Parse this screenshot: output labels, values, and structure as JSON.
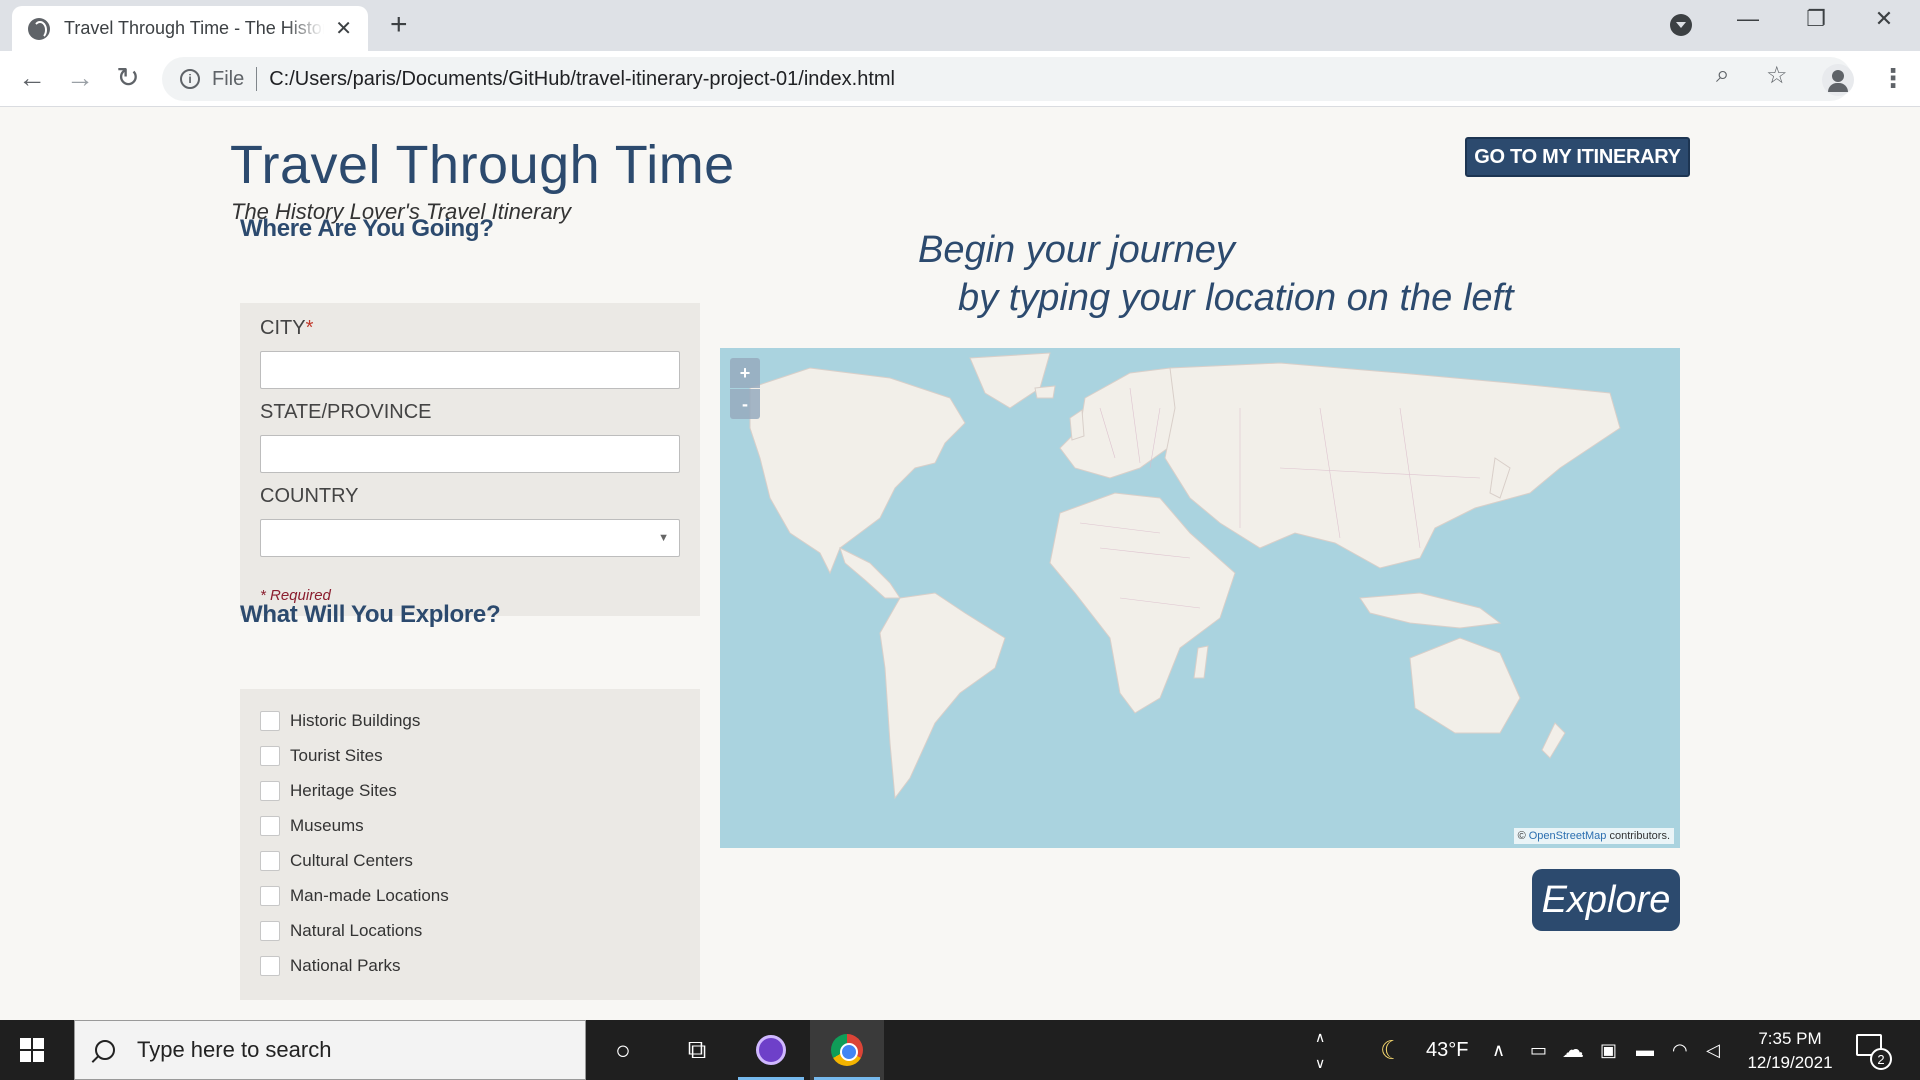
{
  "browser": {
    "tab_title": "Travel Through Time - The History Lover's Travel Itinerary",
    "new_tab": "+",
    "close": "✕",
    "scheme": "File",
    "url": "C:/Users/paris/Documents/GitHub/travel-itinerary-project-01/index.html",
    "minimize": "—",
    "restore": "❐",
    "window_close": "✕",
    "back": "←",
    "forward": "→",
    "reload": "↻",
    "zoom": "⌕",
    "star": "☆",
    "menu": "⋮"
  },
  "header": {
    "title": "Travel Through Time",
    "subtitle": "The History Lover's Travel Itinerary",
    "itinerary_button": "GO TO MY ITINERARY"
  },
  "location_form": {
    "heading": "Where Are You Going?",
    "city_label": "CITY",
    "required_star": "*",
    "state_label": "STATE/PROVINCE",
    "country_label": "COUNTRY",
    "country_value": "",
    "select_caret": "▼",
    "required_note": "* Required"
  },
  "explore_form": {
    "heading": "What Will You Explore?",
    "options": [
      "Historic Buildings",
      "Tourist Sites",
      "Heritage Sites",
      "Museums",
      "Cultural Centers",
      "Man-made Locations",
      "Natural Locations",
      "National Parks"
    ]
  },
  "tagline": {
    "line1": "Begin your journey",
    "line2": "by typing your location on the left"
  },
  "map": {
    "zoom_in": "+",
    "zoom_out": "-",
    "attribution_prefix": "©",
    "attribution_link": "OpenStreetMap",
    "attribution_suffix": "contributors.",
    "water_color": "#aad3df",
    "land_color": "#f2efe9"
  },
  "explore_button": "Explore",
  "taskbar": {
    "search_placeholder": "Type here to search",
    "cortana": "○",
    "task_view": "⧉",
    "scroll_up": "∧",
    "scroll_down": "∨",
    "weather_icon": "☾",
    "temperature": "43°F",
    "tray_chevron": "∧",
    "time": "7:35 PM",
    "date": "12/19/2021",
    "notification_count": "2"
  }
}
